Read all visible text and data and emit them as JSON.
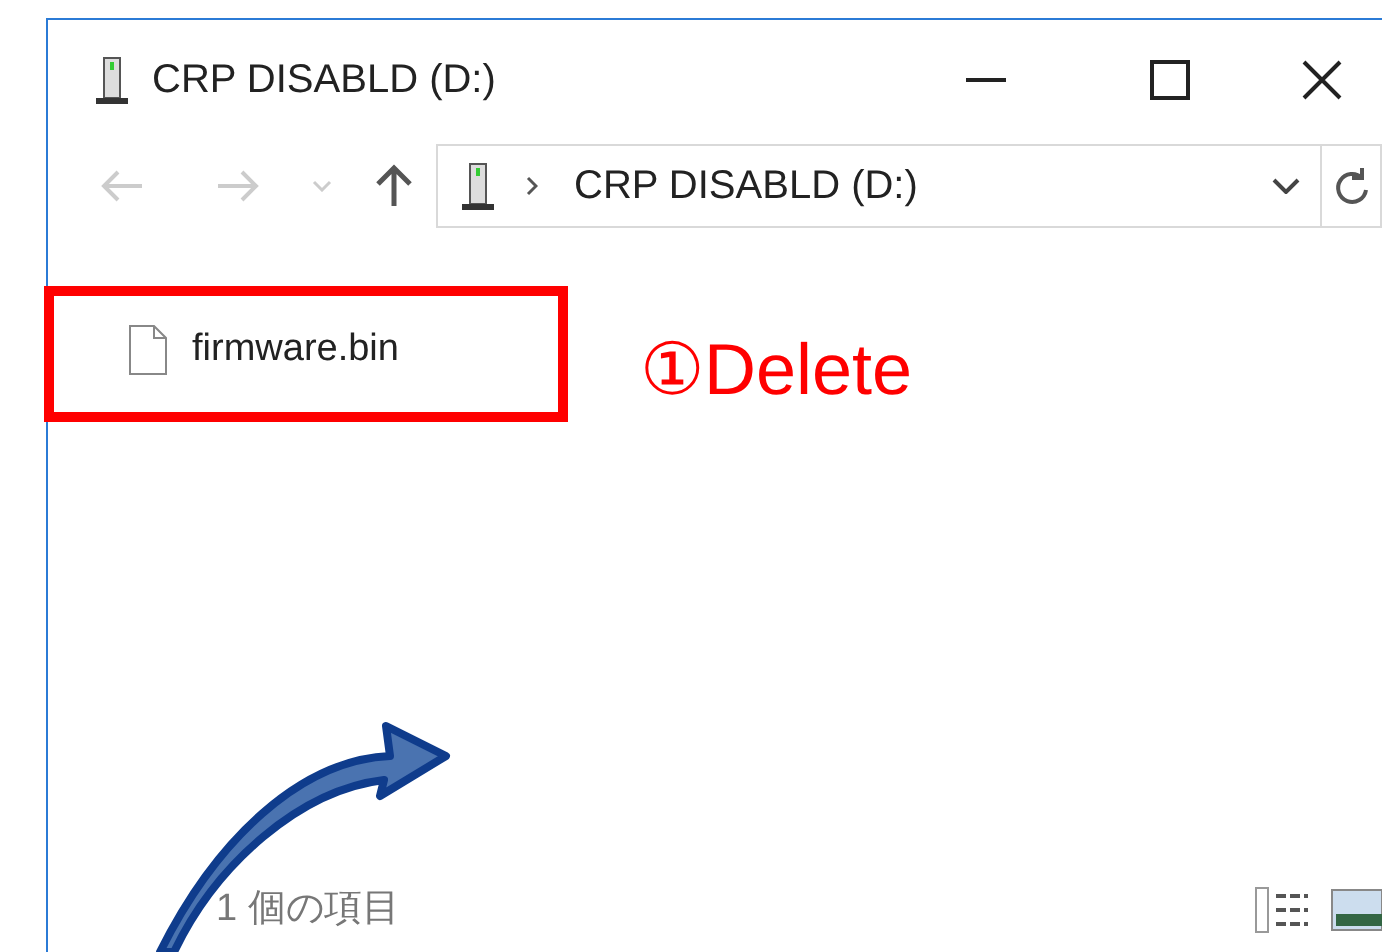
{
  "window": {
    "title": "CRP DISABLD (D:)"
  },
  "address_bar": {
    "path": "CRP DISABLD (D:)"
  },
  "files": [
    {
      "name": "firmware.bin"
    }
  ],
  "annotation": {
    "label": "①Delete"
  },
  "status_bar": {
    "item_count": "1 個の項目"
  }
}
